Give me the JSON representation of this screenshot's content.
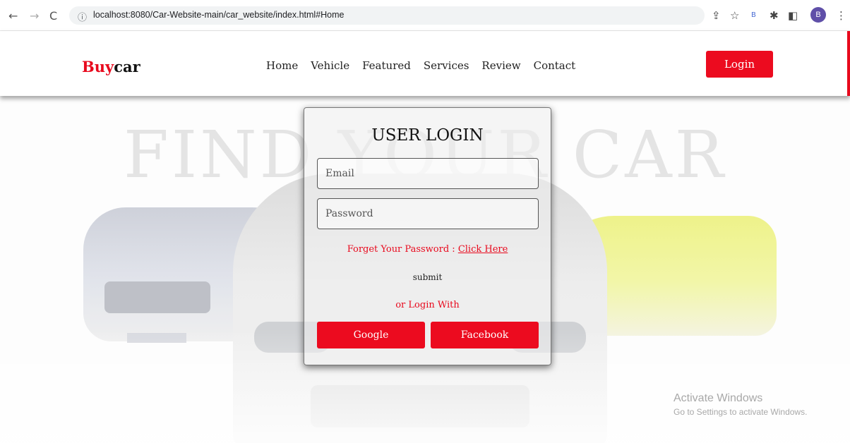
{
  "browser": {
    "back_icon": "←",
    "forward_icon": "→",
    "reload_icon": "C",
    "info_icon": "ⓘ",
    "url": "localhost:8080/Car-Website-main/car_website/index.html#Home",
    "avatar_letter": "B"
  },
  "header": {
    "logo_part1": "Buy",
    "logo_part2": "car",
    "nav": [
      "Home",
      "Vehicle",
      "Featured",
      "Services",
      "Review",
      "Contact"
    ],
    "login_label": "Login"
  },
  "hero": {
    "title": "FIND YOUR CAR"
  },
  "login_card": {
    "title": "USER LOGIN",
    "email_placeholder": "Email",
    "password_placeholder": "Password",
    "forget_text": "Forget Your Password : ",
    "forget_link": "Click Here",
    "submit_label": "submit",
    "or_login_with": "or Login With",
    "google_label": "Google",
    "facebook_label": "Facebook"
  },
  "watermark": {
    "line1": "Activate Windows",
    "line2": "Go to Settings to activate Windows."
  },
  "colors": {
    "brand_red": "#ec0b1f"
  }
}
